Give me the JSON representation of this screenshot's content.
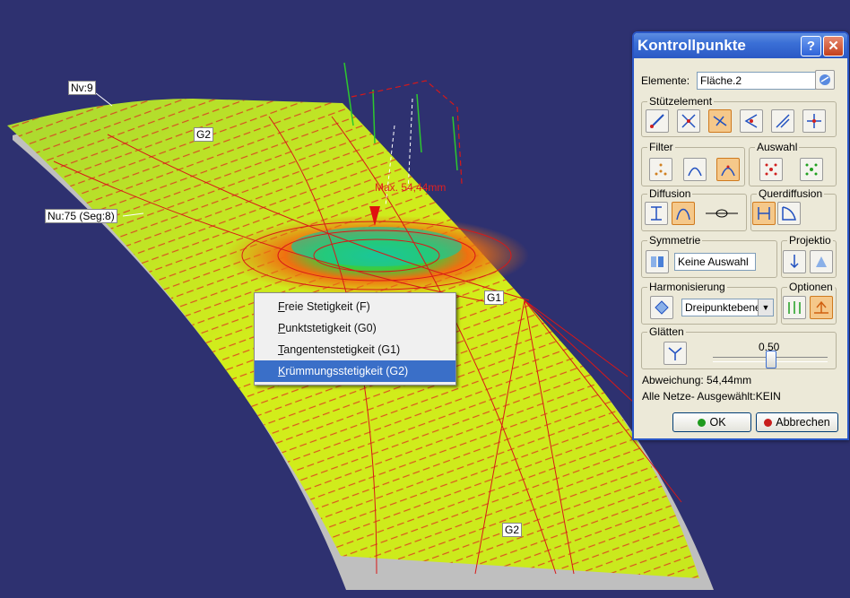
{
  "viewport": {
    "labels": {
      "nv": "Nv:9",
      "nu": "Nu:75 (Seg:8)",
      "g2_top": "G2",
      "g1": "G1",
      "g2_bottom": "G2",
      "max": "Max. 54,44mm"
    }
  },
  "context_menu": {
    "items": [
      {
        "accel": "F",
        "rest": "reie Stetigkeit (F)"
      },
      {
        "accel": "P",
        "rest": "unktstetigkeit (G0)"
      },
      {
        "accel": "T",
        "rest": "angentenstetigkeit (G1)"
      },
      {
        "accel": "K",
        "rest": "rümmungsstetigkeit (G2)"
      }
    ],
    "selected_index": 3
  },
  "dialog": {
    "title": "Kontrollpunkte",
    "help_glyph": "?",
    "close_glyph": "✕",
    "elements_label": "Elemente:",
    "elements_value": "Fläche.2",
    "groups": {
      "stuetzelement": "Stützelement",
      "filter": "Filter",
      "auswahl": "Auswahl",
      "diffusion": "Diffusion",
      "querdiffusion": "Querdiffusion",
      "symmetrie": "Symmetrie",
      "projektion": "Projektio",
      "harmonisierung": "Harmonisierung",
      "optionen": "Optionen",
      "glaetten": "Glätten"
    },
    "symmetrie_value": "Keine Auswahl",
    "harmonisierung_value": "Dreipunktebene",
    "dropdown_glyph": "▼",
    "slider_value": "0.50",
    "slider_fraction": 0.5,
    "deviation": "Abweichung: 54,44mm",
    "nets": "Alle Netze- Ausgewählt:KEIN",
    "ok_label": "OK",
    "cancel_label": "Abbrechen",
    "colors": {
      "ok_dot": "#1e9a1e",
      "cancel_dot": "#c81e1e",
      "active_button": "#f5c88a"
    }
  }
}
